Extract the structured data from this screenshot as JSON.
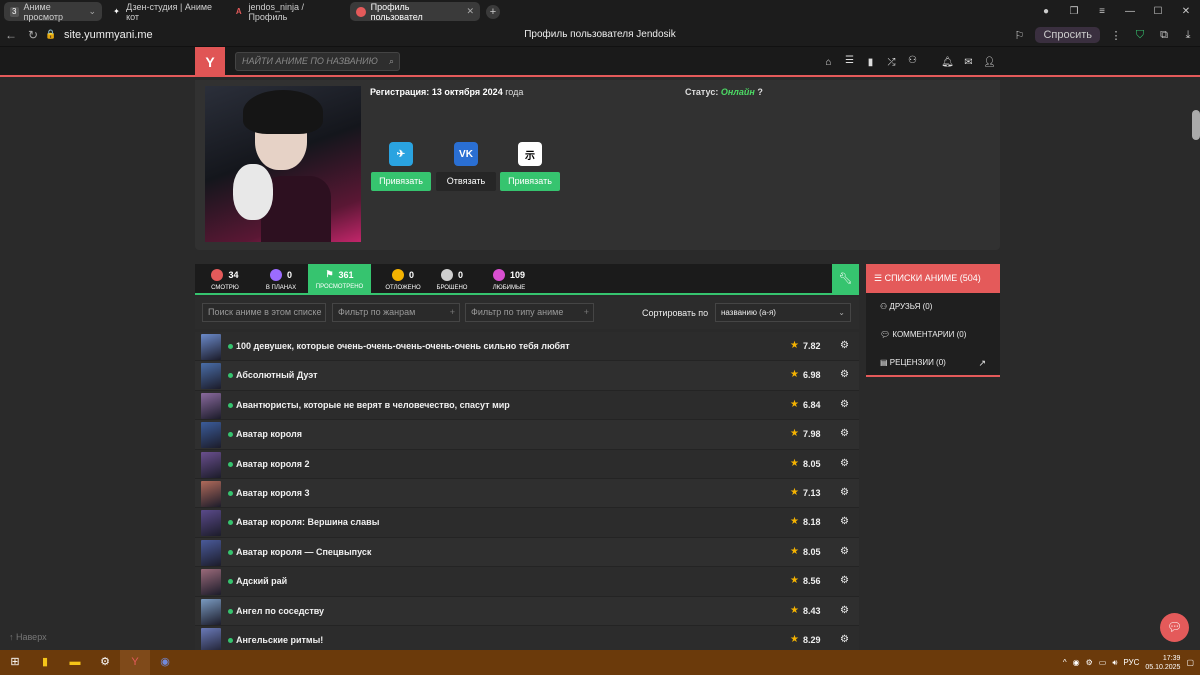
{
  "browser": {
    "tabs": [
      {
        "label": "Аниме просмотр",
        "badge": "3",
        "active": false
      },
      {
        "label": "Дзен-студия | Аниме кот",
        "active": false
      },
      {
        "label": "jendos_ninja / Профиль",
        "active": false
      },
      {
        "label": "Профиль пользовател",
        "active": true
      }
    ],
    "url": "site.yummyani.me",
    "page_title": "Профиль пользователя Jendosik",
    "ask_label": "Спросить"
  },
  "site": {
    "search_placeholder": "НАЙТИ АНИМЕ ПО НАЗВАНИЮ",
    "logo_letter": "Y"
  },
  "profile": {
    "registration_label": "Регистрация:",
    "registration_date": "13 октября 2024",
    "registration_suffix": "года",
    "status_label": "Статус:",
    "status_value": "Онлайн",
    "socials": [
      {
        "name": "telegram",
        "button": "Привязать",
        "color": "#2aa3e0",
        "glyph": "✈",
        "bound": false
      },
      {
        "name": "vk",
        "button": "Отвязать",
        "color": "#2a6fd3",
        "glyph": "VK",
        "bound": true
      },
      {
        "name": "shikimori",
        "button": "Привязать",
        "color": "#ffffff",
        "glyph": "示",
        "bound": false
      }
    ]
  },
  "counters": [
    {
      "value": "34",
      "label": "СМОТРЮ",
      "color": "#e45a5a"
    },
    {
      "value": "0",
      "label": "В ПЛАНАХ",
      "color": "#9b6cff"
    },
    {
      "value": "361",
      "label": "ПРОСМОТРЕНО",
      "color": "#ffffff",
      "selected": true
    },
    {
      "value": "0",
      "label": "ОТЛОЖЕНО",
      "color": "#f5b301"
    },
    {
      "value": "0",
      "label": "БРОШЕНО",
      "color": "#cfcfcf"
    },
    {
      "value": "109",
      "label": "ЛЮБИМЫЕ",
      "color": "#d94fd1"
    }
  ],
  "filters": {
    "list_search_placeholder": "Поиск аниме в этом списке",
    "genre_placeholder": "Фильтр по жанрам",
    "type_placeholder": "Фильтр по типу аниме",
    "sort_label": "Сортировать по",
    "sort_value": "названию (а-я)"
  },
  "anime": [
    {
      "title": "100 девушек, которые очень-очень-очень-очень-очень сильно тебя любят",
      "score": "7.82",
      "thumb": "#6b8ac9"
    },
    {
      "title": "Абсолютный Дуэт",
      "score": "6.98",
      "thumb": "#4a6ea8"
    },
    {
      "title": "Авантюристы, которые не верят в человечество, спасут мир",
      "score": "6.84",
      "thumb": "#8a6a9e"
    },
    {
      "title": "Аватар короля",
      "score": "7.98",
      "thumb": "#3b5c9a"
    },
    {
      "title": "Аватар короля 2",
      "score": "8.05",
      "thumb": "#6a4f8e"
    },
    {
      "title": "Аватар короля 3",
      "score": "7.13",
      "thumb": "#b06a5a"
    },
    {
      "title": "Аватар короля: Вершина славы",
      "score": "8.18",
      "thumb": "#5a4a8a"
    },
    {
      "title": "Аватар короля — Спецвыпуск",
      "score": "8.05",
      "thumb": "#4a5a9a"
    },
    {
      "title": "Адский рай",
      "score": "8.56",
      "thumb": "#9a6a7a"
    },
    {
      "title": "Ангел по соседству",
      "score": "8.43",
      "thumb": "#7a9ac0"
    },
    {
      "title": "Ангельские ритмы!",
      "score": "8.29",
      "thumb": "#6a7ab8"
    }
  ],
  "sidebar": {
    "header": "СПИСКИ АНИМЕ (504)",
    "items": [
      {
        "label": "ДРУЗЬЯ (0)",
        "icon": "users-icon"
      },
      {
        "label": "КОММЕНТАРИИ (0)",
        "icon": "comment-icon"
      },
      {
        "label": "РЕЦЕНЗИИ (0)",
        "icon": "review-icon"
      }
    ]
  },
  "back_to_top": "↑ Наверх",
  "taskbar": {
    "lang": "РУС",
    "time": "17:39",
    "date": "05.10.2025"
  }
}
